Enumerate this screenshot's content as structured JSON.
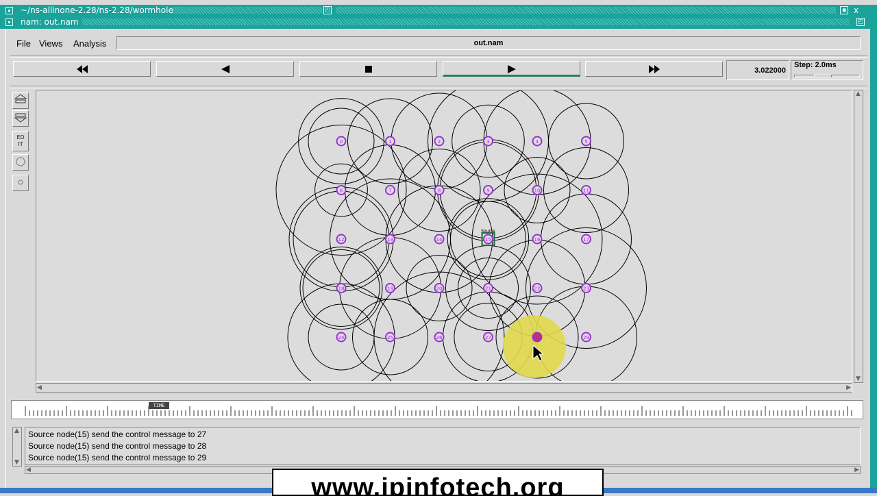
{
  "outer_window": {
    "title": "~/ns-allinone-2.28/ns-2.28/wormhole",
    "close_label": "x"
  },
  "nam_window": {
    "title": "nam: out.nam"
  },
  "menu": {
    "file": "File",
    "views": "Views",
    "analysis": "Analysis"
  },
  "filename": "out.nam",
  "transport": {
    "rewind_icon": "fast-rewind-icon",
    "back_icon": "step-back-icon",
    "stop_icon": "stop-icon",
    "play_icon": "play-icon",
    "forward_icon": "fast-forward-icon"
  },
  "time_display": "3.022000",
  "step": {
    "label": "Step: 2.0ms"
  },
  "tools": {
    "edit_label_1": "ED",
    "edit_label_2": "IT"
  },
  "simulation": {
    "source_tag": "Source",
    "nodes": [
      {
        "id": "0",
        "col": 0,
        "row": 0
      },
      {
        "id": "1",
        "col": 1,
        "row": 0
      },
      {
        "id": "2",
        "col": 2,
        "row": 0
      },
      {
        "id": "3",
        "col": 3,
        "row": 0
      },
      {
        "id": "4",
        "col": 4,
        "row": 0
      },
      {
        "id": "5",
        "col": 5,
        "row": 0
      },
      {
        "id": "6",
        "col": 0,
        "row": 1
      },
      {
        "id": "7",
        "col": 1,
        "row": 1
      },
      {
        "id": "8",
        "col": 2,
        "row": 1
      },
      {
        "id": "9",
        "col": 3,
        "row": 1
      },
      {
        "id": "10",
        "col": 4,
        "row": 1
      },
      {
        "id": "11",
        "col": 5,
        "row": 1
      },
      {
        "id": "12",
        "col": 0,
        "row": 2
      },
      {
        "id": "13",
        "col": 1,
        "row": 2
      },
      {
        "id": "14",
        "col": 2,
        "row": 2
      },
      {
        "id": "15",
        "col": 3,
        "row": 2,
        "source": true
      },
      {
        "id": "16",
        "col": 4,
        "row": 2
      },
      {
        "id": "17",
        "col": 5,
        "row": 2
      },
      {
        "id": "18",
        "col": 0,
        "row": 3
      },
      {
        "id": "19",
        "col": 1,
        "row": 3
      },
      {
        "id": "20",
        "col": 2,
        "row": 3
      },
      {
        "id": "21",
        "col": 3,
        "row": 3
      },
      {
        "id": "22",
        "col": 4,
        "row": 3
      },
      {
        "id": "23",
        "col": 5,
        "row": 3
      },
      {
        "id": "24",
        "col": 0,
        "row": 4
      },
      {
        "id": "25",
        "col": 1,
        "row": 4
      },
      {
        "id": "26",
        "col": 2,
        "row": 4
      },
      {
        "id": "27",
        "col": 3,
        "row": 4
      },
      {
        "id": "28",
        "col": 4,
        "row": 4,
        "highlight": true
      },
      {
        "id": "29",
        "col": 5,
        "row": 4
      }
    ],
    "node_color": "#9b30d9",
    "highlight_color": "#e0d84a",
    "highlight_node_color": "#c0306b"
  },
  "timeline": {
    "marker_label": "TIME"
  },
  "log": [
    "Source node(15) send the control message to 27",
    "Source node(15) send the control message to 28",
    "Source node(15) send the control message to 29"
  ],
  "watermark": "www.ipinfotech.org"
}
